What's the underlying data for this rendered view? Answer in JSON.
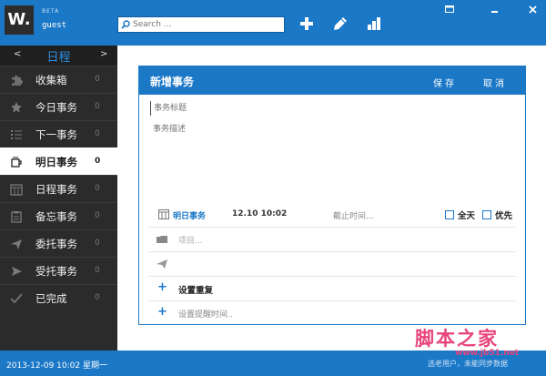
{
  "header": {
    "logo": "W.",
    "badge": "BETA",
    "user": "guest",
    "search_placeholder": "Search ...",
    "toolbar_icons": [
      "plus-icon",
      "pencil-icon",
      "bar-chart-icon"
    ],
    "window_icons": [
      "window-menu-icon",
      "minimize-icon",
      "close-icon"
    ]
  },
  "sidebar": {
    "title": "日程",
    "prev": "<",
    "next": ">",
    "items": [
      {
        "label": "收集箱",
        "count": "0",
        "icon": "puzzle-icon"
      },
      {
        "label": "今日事务",
        "count": "0",
        "icon": "star-icon"
      },
      {
        "label": "下一事务",
        "count": "0",
        "icon": "list-icon"
      },
      {
        "label": "明日事务",
        "count": "0",
        "icon": "coffee-cup-icon",
        "active": true
      },
      {
        "label": "日程事务",
        "count": "0",
        "icon": "calendar-icon"
      },
      {
        "label": "备忘事务",
        "count": "0",
        "icon": "clipboard-icon"
      },
      {
        "label": "委托事务",
        "count": "0",
        "icon": "send-icon"
      },
      {
        "label": "受托事务",
        "count": "0",
        "icon": "receive-icon"
      },
      {
        "label": "已完成",
        "count": "0",
        "icon": "checkmark-icon"
      }
    ]
  },
  "dialog": {
    "title": "新增事务",
    "save": "保存",
    "cancel": "取消",
    "title_placeholder": "事务标题",
    "desc_placeholder": "事务描述",
    "due_label": "明日事务",
    "due_time": "12.10 10:02",
    "deadline": "截止时间...",
    "all_day": "全天",
    "priority": "优先",
    "project": "项目...",
    "repeat": "设置重复",
    "reminder": "设置提醒时间..",
    "plus": "+"
  },
  "status": {
    "datetime": "2013-12-09 10:02 星期一",
    "sync": "选老用户，未能同步数据"
  },
  "watermark": {
    "brand": "脚本之家",
    "url": "www.jb51.net"
  },
  "colors": {
    "accent": "#1b78c7",
    "sidebar": "#2b2b2b",
    "watermark": "#e8457a"
  }
}
